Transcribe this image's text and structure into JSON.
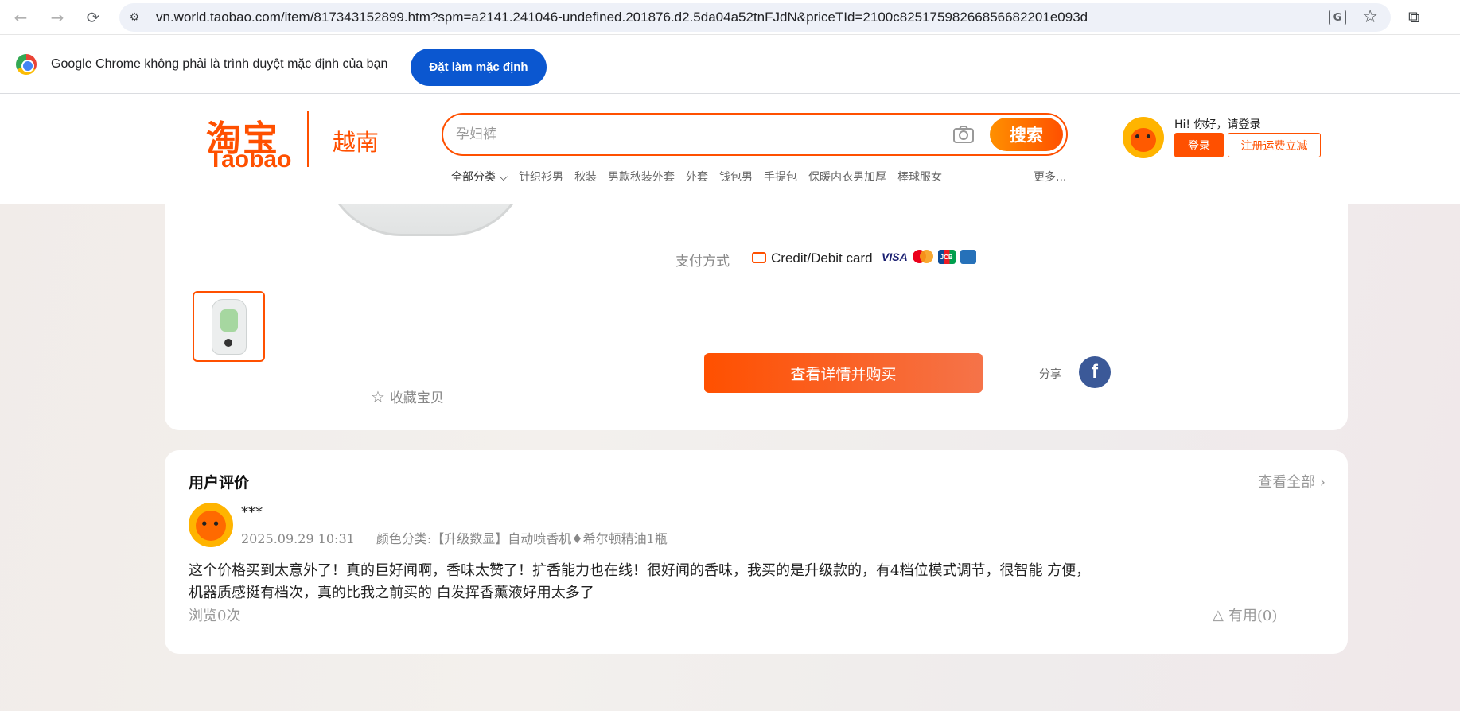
{
  "browser": {
    "url": "vn.world.taobao.com/item/817343152899.htm?spm=a2141.241046-undefined.201876.d2.5da04a52tnFJdN&priceTId=2100c82517598266856682201e093d",
    "infobar_text": "Google Chrome không phải là trình duyệt mặc định của bạn",
    "infobar_button": "Đặt làm mặc định"
  },
  "header": {
    "logo_cn": "淘宝",
    "logo_en": "Taobao",
    "region": "越南",
    "search_placeholder": "孕妇裤",
    "search_button": "搜索",
    "categories": [
      "全部分类 ⌵",
      "针织衫男",
      "秋装",
      "男款秋装外套",
      "外套",
      "钱包男",
      "手提包",
      "保暖内衣男加厚",
      "棒球服女"
    ],
    "more": "更多...",
    "greeting": "Hi! 你好，请登录",
    "login": "登录",
    "register": "注册运费立减"
  },
  "product": {
    "payment_label": "支付方式",
    "payment_method": "Credit/Debit card",
    "visa": "VISA",
    "jcb": "JCB",
    "favorite": "收藏宝贝",
    "buy_button": "查看详情并购买",
    "share_label": "分享",
    "facebook": "f"
  },
  "reviews": {
    "title": "用户评价",
    "view_all": "查看全部 ›",
    "user": "***",
    "date": "2025.09.29 10:31",
    "sku": "颜色分类:【升级数显】自动喷香机♦希尔顿精油1瓶",
    "body_line1": "这个价格买到太意外了！真的巨好闻啊，香味太赞了！扩香能力也在线！很好闻的香味，我买的是升级款的，有4档位模式调节，很智能 方便，",
    "body_line2": "机器质感挺有档次，真的比我之前买的 白发挥香薰液好用太多了",
    "views": "浏览0次",
    "useful": "有用(0)"
  }
}
